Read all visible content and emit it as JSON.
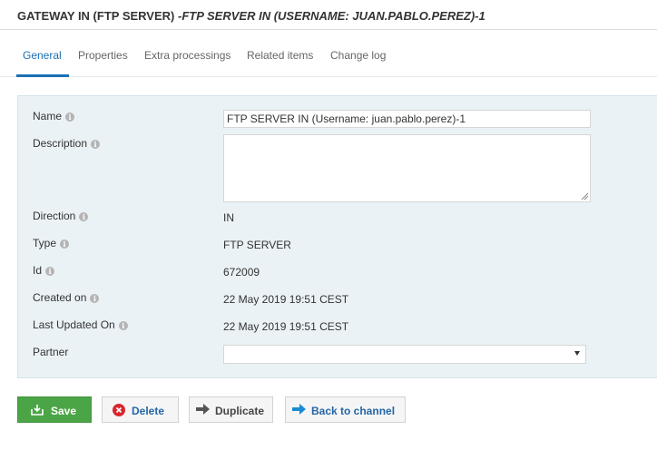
{
  "header": {
    "title_main": "GATEWAY IN (FTP SERVER)",
    "title_sub": "-FTP SERVER IN (USERNAME: JUAN.PABLO.PEREZ)-1"
  },
  "tabs": [
    {
      "label": "General",
      "active": true
    },
    {
      "label": "Properties",
      "active": false
    },
    {
      "label": "Extra processings",
      "active": false
    },
    {
      "label": "Related items",
      "active": false
    },
    {
      "label": "Change log",
      "active": false
    }
  ],
  "form": {
    "name": {
      "label": "Name",
      "value": "FTP SERVER IN (Username: juan.pablo.perez)-1"
    },
    "description": {
      "label": "Description",
      "value": ""
    },
    "direction": {
      "label": "Direction",
      "value": "IN"
    },
    "type": {
      "label": "Type",
      "value": "FTP SERVER"
    },
    "id": {
      "label": "Id",
      "value": "672009"
    },
    "created_on": {
      "label": "Created on",
      "value": "22 May 2019 19:51 CEST"
    },
    "last_updated_on": {
      "label": "Last Updated On",
      "value": "22 May 2019 19:51 CEST"
    },
    "partner": {
      "label": "Partner",
      "value": ""
    }
  },
  "buttons": {
    "save": "Save",
    "delete": "Delete",
    "duplicate": "Duplicate",
    "back": "Back to channel"
  },
  "icons": {
    "info": "info-icon",
    "save": "save-icon",
    "delete": "delete-icon",
    "duplicate": "arrow-right-icon",
    "back": "arrow-right-icon"
  },
  "colors": {
    "accent": "#1b6fb3",
    "save_button": "#4ba546",
    "delete_icon": "#d9272e",
    "panel_bg": "#eaf2f6"
  }
}
